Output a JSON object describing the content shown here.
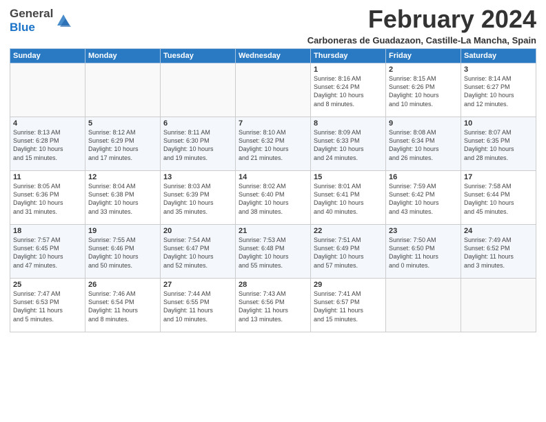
{
  "header": {
    "logo_general": "General",
    "logo_blue": "Blue",
    "month_title": "February 2024",
    "subtitle": "Carboneras de Guadazaon, Castille-La Mancha, Spain"
  },
  "days_of_week": [
    "Sunday",
    "Monday",
    "Tuesday",
    "Wednesday",
    "Thursday",
    "Friday",
    "Saturday"
  ],
  "weeks": [
    [
      {
        "day": "",
        "text": ""
      },
      {
        "day": "",
        "text": ""
      },
      {
        "day": "",
        "text": ""
      },
      {
        "day": "",
        "text": ""
      },
      {
        "day": "1",
        "text": "Sunrise: 8:16 AM\nSunset: 6:24 PM\nDaylight: 10 hours\nand 8 minutes."
      },
      {
        "day": "2",
        "text": "Sunrise: 8:15 AM\nSunset: 6:26 PM\nDaylight: 10 hours\nand 10 minutes."
      },
      {
        "day": "3",
        "text": "Sunrise: 8:14 AM\nSunset: 6:27 PM\nDaylight: 10 hours\nand 12 minutes."
      }
    ],
    [
      {
        "day": "4",
        "text": "Sunrise: 8:13 AM\nSunset: 6:28 PM\nDaylight: 10 hours\nand 15 minutes."
      },
      {
        "day": "5",
        "text": "Sunrise: 8:12 AM\nSunset: 6:29 PM\nDaylight: 10 hours\nand 17 minutes."
      },
      {
        "day": "6",
        "text": "Sunrise: 8:11 AM\nSunset: 6:30 PM\nDaylight: 10 hours\nand 19 minutes."
      },
      {
        "day": "7",
        "text": "Sunrise: 8:10 AM\nSunset: 6:32 PM\nDaylight: 10 hours\nand 21 minutes."
      },
      {
        "day": "8",
        "text": "Sunrise: 8:09 AM\nSunset: 6:33 PM\nDaylight: 10 hours\nand 24 minutes."
      },
      {
        "day": "9",
        "text": "Sunrise: 8:08 AM\nSunset: 6:34 PM\nDaylight: 10 hours\nand 26 minutes."
      },
      {
        "day": "10",
        "text": "Sunrise: 8:07 AM\nSunset: 6:35 PM\nDaylight: 10 hours\nand 28 minutes."
      }
    ],
    [
      {
        "day": "11",
        "text": "Sunrise: 8:05 AM\nSunset: 6:36 PM\nDaylight: 10 hours\nand 31 minutes."
      },
      {
        "day": "12",
        "text": "Sunrise: 8:04 AM\nSunset: 6:38 PM\nDaylight: 10 hours\nand 33 minutes."
      },
      {
        "day": "13",
        "text": "Sunrise: 8:03 AM\nSunset: 6:39 PM\nDaylight: 10 hours\nand 35 minutes."
      },
      {
        "day": "14",
        "text": "Sunrise: 8:02 AM\nSunset: 6:40 PM\nDaylight: 10 hours\nand 38 minutes."
      },
      {
        "day": "15",
        "text": "Sunrise: 8:01 AM\nSunset: 6:41 PM\nDaylight: 10 hours\nand 40 minutes."
      },
      {
        "day": "16",
        "text": "Sunrise: 7:59 AM\nSunset: 6:42 PM\nDaylight: 10 hours\nand 43 minutes."
      },
      {
        "day": "17",
        "text": "Sunrise: 7:58 AM\nSunset: 6:44 PM\nDaylight: 10 hours\nand 45 minutes."
      }
    ],
    [
      {
        "day": "18",
        "text": "Sunrise: 7:57 AM\nSunset: 6:45 PM\nDaylight: 10 hours\nand 47 minutes."
      },
      {
        "day": "19",
        "text": "Sunrise: 7:55 AM\nSunset: 6:46 PM\nDaylight: 10 hours\nand 50 minutes."
      },
      {
        "day": "20",
        "text": "Sunrise: 7:54 AM\nSunset: 6:47 PM\nDaylight: 10 hours\nand 52 minutes."
      },
      {
        "day": "21",
        "text": "Sunrise: 7:53 AM\nSunset: 6:48 PM\nDaylight: 10 hours\nand 55 minutes."
      },
      {
        "day": "22",
        "text": "Sunrise: 7:51 AM\nSunset: 6:49 PM\nDaylight: 10 hours\nand 57 minutes."
      },
      {
        "day": "23",
        "text": "Sunrise: 7:50 AM\nSunset: 6:50 PM\nDaylight: 11 hours\nand 0 minutes."
      },
      {
        "day": "24",
        "text": "Sunrise: 7:49 AM\nSunset: 6:52 PM\nDaylight: 11 hours\nand 3 minutes."
      }
    ],
    [
      {
        "day": "25",
        "text": "Sunrise: 7:47 AM\nSunset: 6:53 PM\nDaylight: 11 hours\nand 5 minutes."
      },
      {
        "day": "26",
        "text": "Sunrise: 7:46 AM\nSunset: 6:54 PM\nDaylight: 11 hours\nand 8 minutes."
      },
      {
        "day": "27",
        "text": "Sunrise: 7:44 AM\nSunset: 6:55 PM\nDaylight: 11 hours\nand 10 minutes."
      },
      {
        "day": "28",
        "text": "Sunrise: 7:43 AM\nSunset: 6:56 PM\nDaylight: 11 hours\nand 13 minutes."
      },
      {
        "day": "29",
        "text": "Sunrise: 7:41 AM\nSunset: 6:57 PM\nDaylight: 11 hours\nand 15 minutes."
      },
      {
        "day": "",
        "text": ""
      },
      {
        "day": "",
        "text": ""
      }
    ]
  ]
}
